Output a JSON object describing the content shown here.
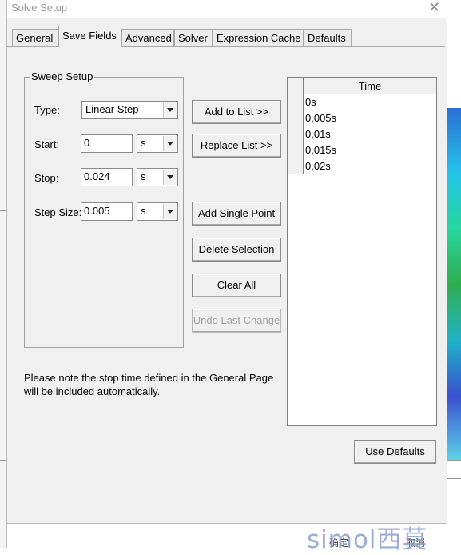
{
  "dialog": {
    "title": "Solve Setup"
  },
  "tabs": [
    {
      "label": "General"
    },
    {
      "label": "Save Fields"
    },
    {
      "label": "Advanced"
    },
    {
      "label": "Solver"
    },
    {
      "label": "Expression Cache"
    },
    {
      "label": "Defaults"
    }
  ],
  "active_tab": "Save Fields",
  "sweep": {
    "group_label": "Sweep Setup",
    "type_label": "Type:",
    "type_value": "Linear Step",
    "start_label": "Start:",
    "start_value": "0",
    "start_unit": "s",
    "stop_label": "Stop:",
    "stop_value": "0.024",
    "stop_unit": "s",
    "step_label": "Step Size:",
    "step_value": "0.005",
    "step_unit": "s"
  },
  "buttons": {
    "add_to_list": "Add to List >>",
    "replace_list": "Replace List >>",
    "add_single_point": "Add Single Point",
    "delete_selection": "Delete Selection",
    "clear_all": "Clear All",
    "undo_last_change": "Undo Last Change",
    "use_defaults": "Use Defaults"
  },
  "grid": {
    "header": "Time",
    "rows": [
      "0s",
      "0.005s",
      "0.01s",
      "0.015s",
      "0.02s"
    ]
  },
  "note": {
    "line1": "Please note the stop time defined in the General Page",
    "line2": "will be included automatically."
  },
  "footer": {
    "ok_label": "确定",
    "cancel_label": "取消"
  },
  "watermark": {
    "text": "simol西莫"
  },
  "colors": {
    "dialog_bg": "#f0f0f0",
    "title_text": "#9a9a9a",
    "disabled_text": "#a3a3a3",
    "watermark": "#8b9fd1"
  }
}
